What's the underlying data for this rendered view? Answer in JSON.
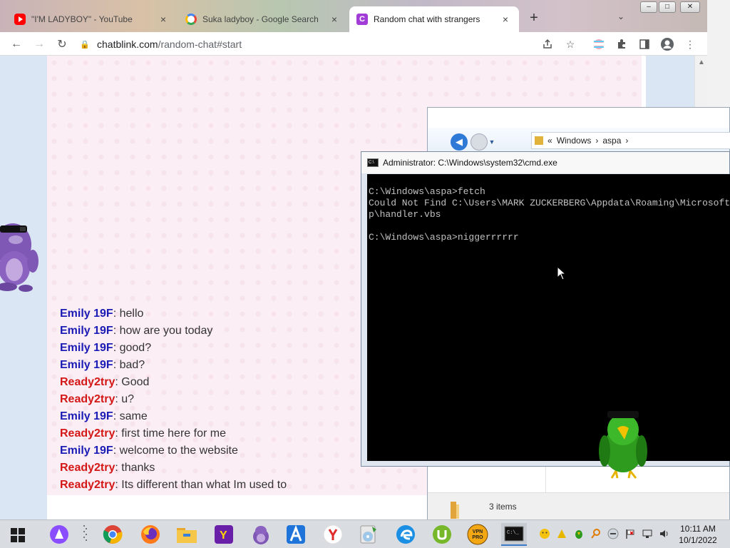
{
  "browser": {
    "tabs": [
      {
        "title": "\"I'M LADYBOY\" - YouTube",
        "icon": "youtube-icon"
      },
      {
        "title": "Suka ladyboy - Google Search",
        "icon": "google-icon"
      },
      {
        "title": "Random chat with strangers",
        "icon": "chatblink-icon",
        "active": true
      }
    ],
    "url_host": "chatblink.com",
    "url_path": "/random-chat#start"
  },
  "chat": {
    "messages": [
      {
        "user": "Emily 19F",
        "color": "blue",
        "text": ": hello"
      },
      {
        "user": "Emily 19F",
        "color": "blue",
        "text": ": how are you today"
      },
      {
        "user": "Emily 19F",
        "color": "blue",
        "text": ": good?"
      },
      {
        "user": "Emily 19F",
        "color": "blue",
        "text": ": bad?"
      },
      {
        "user": "Ready2try",
        "color": "red",
        "text": ": Good"
      },
      {
        "user": "Ready2try",
        "color": "red",
        "text": ": u?"
      },
      {
        "user": "Emily 19F",
        "color": "blue",
        "text": ": same"
      },
      {
        "user": "Ready2try",
        "color": "red",
        "text": ": first time here for me"
      },
      {
        "user": "Emily 19F",
        "color": "blue",
        "text": ": welcome to the website"
      },
      {
        "user": "Ready2try",
        "color": "red",
        "text": ": thanks"
      },
      {
        "user": "Ready2try",
        "color": "red",
        "text": ": Its different than what Im used to"
      }
    ]
  },
  "explorer": {
    "breadcrumb": [
      "«",
      "Windows",
      "›",
      "aspa",
      "›"
    ],
    "status": "3 items"
  },
  "cmd": {
    "title": "Administrator: C:\\Windows\\system32\\cmd.exe",
    "icon_text": "C:\\",
    "lines": [
      "C:\\Windows\\aspa>fetch",
      "Could Not Find C:\\Users\\MARK ZUCKERBERG\\Appdata\\Roaming\\Microsoft",
      "p\\handler.vbs",
      "",
      "C:\\Windows\\aspa>niggerrrrrr"
    ]
  },
  "taskbar": {
    "time": "10:11 AM",
    "date": "10/1/2022",
    "vpn_label": "VPN PRO"
  },
  "colors": {
    "chat_bg": "#fbeef4",
    "user_blue": "#1b1bb5",
    "user_red": "#d41818",
    "page_side": "#dbe6f5"
  }
}
